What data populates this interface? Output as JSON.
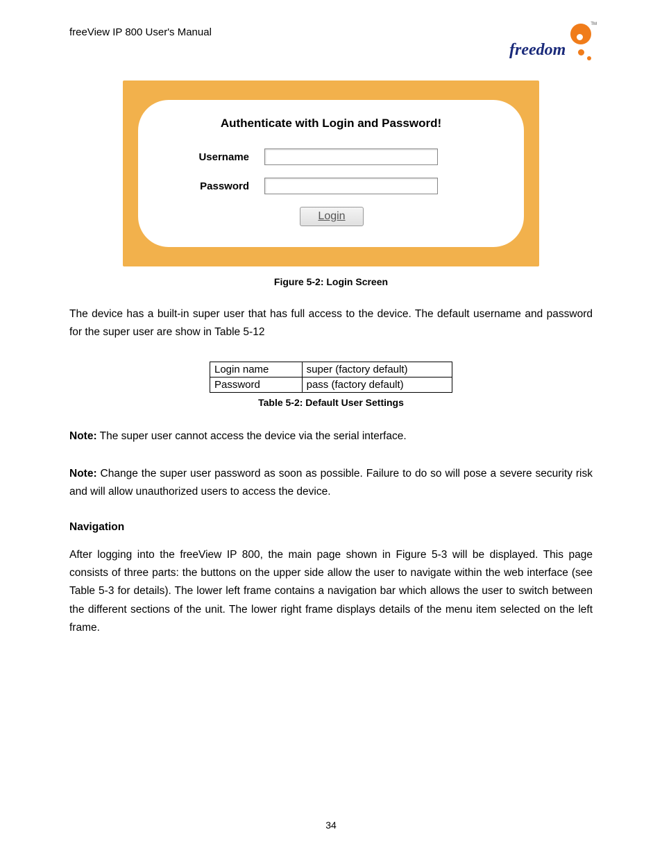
{
  "header": {
    "manual_title": "freeView IP 800 User's Manual",
    "logo_text": "freedom",
    "logo_tm": "TM"
  },
  "login_screen": {
    "heading": "Authenticate with Login and Password!",
    "username_label": "Username",
    "password_label": "Password",
    "username_value": "",
    "password_value": "",
    "button_label": "Login",
    "caption": "Figure 5-2: Login Screen"
  },
  "paragraphs": {
    "p1": "The device has a built-in super user that has full access to the device.   The default username and password for the super user are show in Table 5-12",
    "note1_label": "Note:",
    "note1_text": " The super user cannot access the device via the serial interface.",
    "note2_label": "Note:",
    "note2_text": " Change the super user password as soon as possible.  Failure to do so will pose a severe security risk and will allow unauthorized users to access the device.",
    "nav_heading": "Navigation",
    "nav_text": "After logging into the freeView IP 800, the main page shown in Figure 5-3 will be displayed. This page consists of three parts: the buttons on the upper side allow the user to navigate within the web interface (see Table 5-3 for details). The lower left frame contains a navigation bar which allows the user to switch between the different sections of the unit. The lower right frame displays details of the menu item selected on the left frame."
  },
  "cred_table": {
    "rows": [
      {
        "k": "Login name",
        "v": "super (factory default)"
      },
      {
        "k": "Password",
        "v": "pass (factory default)"
      }
    ],
    "caption": "Table 5-2: Default User Settings"
  },
  "page_number": "34"
}
